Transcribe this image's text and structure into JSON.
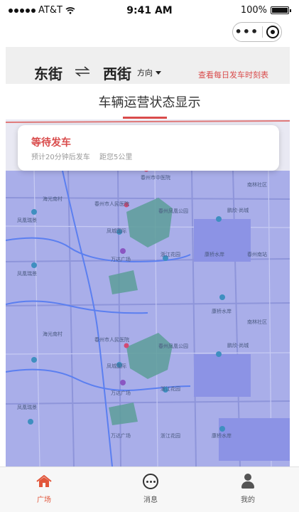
{
  "status_bar": {
    "carrier": "AT&T",
    "time": "9:41 AM",
    "battery": "100%"
  },
  "capsule": {
    "more_icon": "more-dots-icon",
    "close_icon": "target-circle-icon"
  },
  "route": {
    "from": "东街",
    "to": "西街",
    "direction_label": "方向",
    "timetable_link": "查看每日发车时刻表",
    "swap_icon": "swap-arrows-icon"
  },
  "page_title": "车辆运营状态显示",
  "status_card": {
    "title": "等待发车",
    "eta": "预计20分钟后发车",
    "distance": "距您5公里"
  },
  "map_labels": [
    "春州市中医院",
    "海光南村",
    "春州市人民医院",
    "凤凰瑞景",
    "春州凤凰公园",
    "鹏欣·尚城",
    "南林社区",
    "凤城国际",
    "万达广场",
    "浙江花园",
    "康桥水岸",
    "春州南站",
    "凤凰瑞景",
    "海光南村",
    "春州市人民医院",
    "春州凤凰公园",
    "鹏欣·尚城",
    "凤城国际",
    "万达广场",
    "浙江花园",
    "康桥水岸",
    "南林社区",
    "凤凰瑞景",
    "万达广场",
    "浙江花园",
    "康桥水岸"
  ],
  "tabs": [
    {
      "label": "广场",
      "icon": "home-icon",
      "active": true
    },
    {
      "label": "消息",
      "icon": "message-icon",
      "active": false
    },
    {
      "label": "我的",
      "icon": "user-icon",
      "active": false
    }
  ],
  "colors": {
    "accent": "#d94b4b",
    "map": "#a9aee9",
    "tab_active": "#e2563b"
  }
}
